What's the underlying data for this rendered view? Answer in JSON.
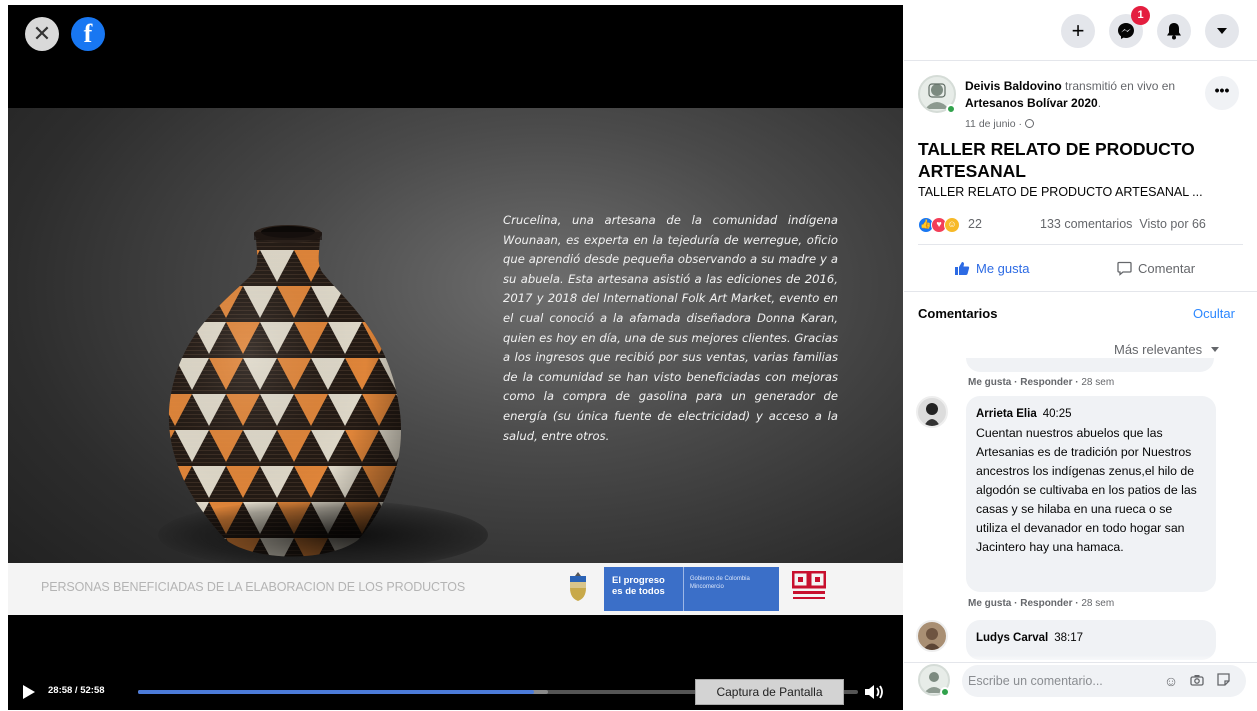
{
  "video": {
    "caption": "Crucelina, una artesana de la comunidad indígena Wounaan, es experta en la tejeduría de werregue, oficio que aprendió desde pequeña observando a su madre y a su abuela. Esta artesana asistió a las ediciones de 2016,  2017 y 2018 del International Folk Art Market, evento en el cual conoció a la afamada diseñadora Donna Karan, quien es hoy en día, una de sus mejores clientes.    Gracias a los ingresos que recibió por sus ventas, varias familias de la comunidad se han visto beneficiadas con mejoras como la compra de gasolina para un generador de energía (su única fuente de electricidad) y acceso a la salud, entre otros.",
    "banner_text": "PERSONAS BENEFICIADAS DE LA ELABORACION DE LOS PRODUCTOS",
    "gov_logo_line1": "El progreso",
    "gov_logo_line2": "es de todos",
    "gov_logo_small": "Gobierno de Colombia Mincomercio",
    "time_display": "28:58 / 52:58",
    "progress_fraction": 0.55,
    "tooltip": "Captura de Pantalla"
  },
  "header": {
    "notification_count": "1"
  },
  "post": {
    "author": "Deivis Baldovino",
    "action_text": "transmitió en vivo en",
    "group": "Artesanos Bolívar 2020",
    "date": "11 de junio ·",
    "title": "TALLER RELATO DE PRODUCTO ARTESANAL",
    "subtitle": "TALLER RELATO DE PRODUCTO ARTESANAL ...",
    "reaction_count": "22",
    "comment_count": "133 comentarios",
    "views": "Visto por 66",
    "like_label": "Me gusta",
    "comment_label": "Comentar"
  },
  "comments": {
    "header": "Comentarios",
    "hide_label": "Ocultar",
    "sort_label": "Más relevantes",
    "like_action": "Me gusta",
    "reply_action": "Responder",
    "items": [
      {
        "time_ago": "28 sem",
        "author": "Arrieta Elia",
        "timestamp": "40:25",
        "text": "Cuentan nuestros abuelos que las Artesanias es de tradición por Nuestros ancestros los indígenas zenus,el hilo de algodón se cultivaba en los patios de las casas y se hilaba en una rueca o se utiliza el devanador en todo hogar san Jacintero hay una hamaca."
      },
      {
        "author": "Ludys Carval",
        "timestamp": "38:17"
      }
    ],
    "composer_placeholder": "Escribe un comentario..."
  },
  "colors": {
    "facebook_blue": "#1877f2",
    "link_blue": "#2d88ff",
    "badge_red": "#e41e3f",
    "online_green": "#31a24c",
    "vase_orange": "#e98a3b",
    "vase_black": "#1a1512",
    "vase_cream": "#e8e1d2"
  },
  "icons": [
    "close-icon",
    "facebook-logo-icon",
    "plus-icon",
    "messenger-icon",
    "bell-icon",
    "caret-down-icon",
    "globe-icon",
    "like-icon",
    "comment-icon",
    "play-icon",
    "volume-icon",
    "emoji-icon",
    "camera-icon",
    "sticker-icon"
  ]
}
